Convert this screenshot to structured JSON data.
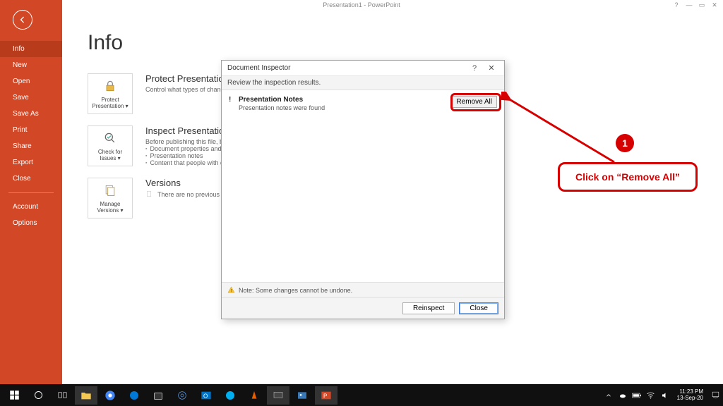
{
  "window": {
    "title": "Presentation1 - PowerPoint"
  },
  "sidebar": {
    "items": [
      "Info",
      "New",
      "Open",
      "Save",
      "Save As",
      "Print",
      "Share",
      "Export",
      "Close"
    ],
    "bottom": [
      "Account",
      "Options"
    ],
    "active": 0
  },
  "page": {
    "title": "Info",
    "sections": {
      "protect": {
        "btn_line1": "Protect",
        "btn_line2": "Presentation ▾",
        "heading": "Protect Presentation",
        "desc": "Control what types of changes people can make to this presentation."
      },
      "inspect": {
        "btn_line1": "Check for",
        "btn_line2": "Issues ▾",
        "heading": "Inspect Presentation",
        "desc": "Before publishing this file, be aware that it contains:",
        "bullets": [
          "Document properties and author's name",
          "Presentation notes",
          "Content that people with disabilities are unable to read"
        ]
      },
      "versions": {
        "btn_line1": "Manage",
        "btn_line2": "Versions ▾",
        "heading": "Versions",
        "desc": "There are no previous versions of this file."
      }
    }
  },
  "dialog": {
    "title": "Document Inspector",
    "instruction": "Review the inspection results.",
    "result": {
      "heading": "Presentation Notes",
      "detail": "Presentation notes were found"
    },
    "remove_all": "Remove All",
    "note": "Note: Some changes cannot be undone.",
    "reinspect": "Reinspect",
    "close": "Close"
  },
  "annotation": {
    "num": "1",
    "text": "Click on “Remove All”"
  },
  "taskbar": {
    "time": "11:23 PM",
    "date": "13-Sep-20"
  }
}
